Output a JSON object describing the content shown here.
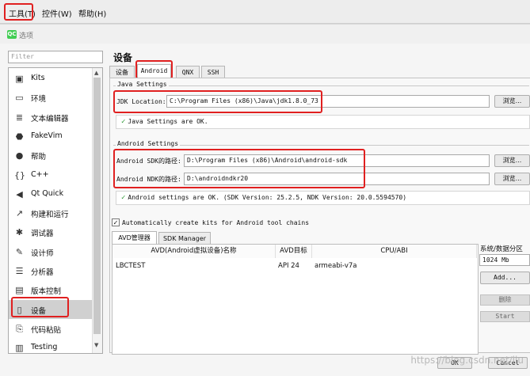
{
  "menubar": {
    "items": [
      "工具(T)",
      "控件(W)",
      "帮助(H)"
    ]
  },
  "dialog": {
    "title": "选项",
    "logo_text": "QC"
  },
  "filter": {
    "placeholder": "Filter"
  },
  "categories": [
    {
      "label": "Kits",
      "icon": "kits-icon",
      "glyph": "▣"
    },
    {
      "label": "环境",
      "icon": "monitor-icon",
      "glyph": "▭"
    },
    {
      "label": "文本编辑器",
      "icon": "text-editor-icon",
      "glyph": "≣"
    },
    {
      "label": "FakeVim",
      "icon": "fakevim-icon",
      "glyph": "⬣"
    },
    {
      "label": "帮助",
      "icon": "help-icon",
      "glyph": "●"
    },
    {
      "label": "C++",
      "icon": "braces-icon",
      "glyph": "{}"
    },
    {
      "label": "Qt Quick",
      "icon": "qtquick-icon",
      "glyph": "◀"
    },
    {
      "label": "构建和运行",
      "icon": "hammer-icon",
      "glyph": "↗"
    },
    {
      "label": "调试器",
      "icon": "bug-icon",
      "glyph": "✱"
    },
    {
      "label": "设计师",
      "icon": "pencil-icon",
      "glyph": "✎"
    },
    {
      "label": "分析器",
      "icon": "analyzer-icon",
      "glyph": "☰"
    },
    {
      "label": "版本控制",
      "icon": "version-control-icon",
      "glyph": "▤"
    },
    {
      "label": "设备",
      "icon": "device-icon",
      "glyph": "▯"
    },
    {
      "label": "代码粘贴",
      "icon": "paste-icon",
      "glyph": "⎘"
    },
    {
      "label": "Testing",
      "icon": "testing-icon",
      "glyph": "▥"
    }
  ],
  "page": {
    "title": "设备",
    "tabs": [
      "设备",
      "Android",
      "QNX",
      "SSH"
    ]
  },
  "java": {
    "group": "Java Settings",
    "jdk_label": "JDK Location:",
    "jdk_value": "C:\\Program Files (x86)\\Java\\jdk1.8.0_73",
    "browse": "浏览...",
    "status": "Java Settings are OK."
  },
  "android": {
    "group": "Android Settings",
    "sdk_label": "Android SDK的路径:",
    "sdk_value": "D:\\Program Files (x86)\\Android\\android-sdk",
    "ndk_label": "Android NDK的路径:",
    "ndk_value": "D:\\androidndkr20",
    "browse": "浏览...",
    "status": "Android settings are OK.  (SDK Version: 25.2.5, NDK Version: 20.0.5594570)"
  },
  "auto_kits": {
    "label": "Automatically create kits for Android tool chains",
    "checked": true
  },
  "sub_tabs": [
    "AVD管理器",
    "SDK Manager"
  ],
  "avd": {
    "headers": [
      "AVD(Android虚拟设备)名称",
      "AVD目标",
      "CPU/ABI"
    ],
    "rows": [
      [
        "LBCTEST",
        "API 24",
        "armeabi-v7a"
      ]
    ],
    "partition_label": "系统/数据分区",
    "partition_value": "1024 Mb",
    "add": "Add...",
    "delete": "删除",
    "start": "Start"
  },
  "footer": {
    "ok": "OK",
    "cancel": "Cancel",
    "watermark": "https://blog.csdn.net/liu"
  }
}
